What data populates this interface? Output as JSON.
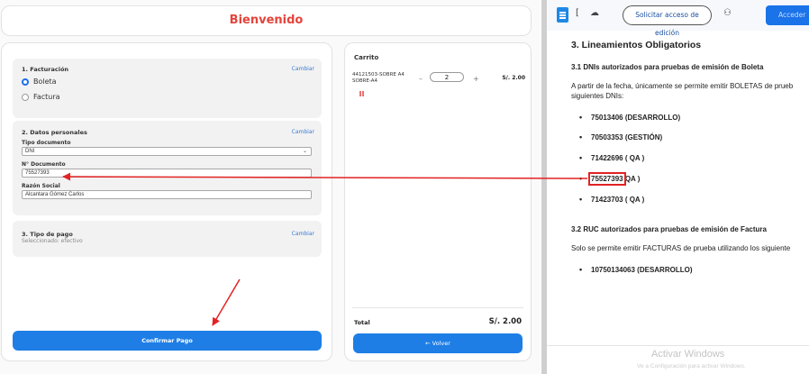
{
  "app": {
    "title": "Bienvenido",
    "billing": {
      "title": "1. Facturación",
      "change": "Cambiar",
      "options": [
        "Boleta",
        "Factura"
      ],
      "selected": "Boleta"
    },
    "personal": {
      "title": "2. Datos personales",
      "change": "Cambiar",
      "doc_type_label": "Tipo documento",
      "doc_type_value": "DNI",
      "doc_number_label": "N° Documento",
      "doc_number_value": "75527393",
      "name_label": "Razón Social",
      "name_value": "Alcantara Gómez Carlos"
    },
    "payment": {
      "title": "3. Tipo de pago",
      "subtitle": "Seleccionado: efectivo",
      "change": "Cambiar"
    },
    "confirm_label": "Confirmar Pago"
  },
  "cart": {
    "title": "Carrito",
    "items": [
      {
        "name": "44121503-SOBRE A4 SOBRE-A4",
        "qty": "2",
        "price": "S/. 2.00"
      }
    ],
    "minus": "–",
    "plus": "+",
    "total_label": "Total",
    "total_value": "S/. 2.00",
    "back_label": "← Volver"
  },
  "doc": {
    "toolbar": {
      "request_access": "Solicitar acceso de edición",
      "access": "Acceder"
    },
    "heading": "3. Lineamientos Obligatorios",
    "sec31": "3.1 DNIs autorizados para pruebas de emisión de Boleta",
    "sec31_p1": "A partir de la fecha, únicamente se permite emitir BOLETAS de prueb",
    "sec31_p2": "siguientes DNIs:",
    "dnis": [
      "75013406 (DESARROLLO)",
      "70503353 (GESTIÓN)",
      "71422696 ( QA )",
      "75527393",
      "71423703 ( QA )"
    ],
    "dni4_suffix": " QA )",
    "sec32": "3.2 RUC autorizados para pruebas de emisión de Factura",
    "sec32_p": "Solo se permite emitir FACTURAS de prueba utilizando los siguiente",
    "rucs": [
      "10750134063 (DESARROLLO)"
    ],
    "watermark1": "Activar Windows",
    "watermark2": "Ve a Configuración para activar Windows."
  },
  "colors": {
    "accent": "#1e7ee6",
    "title_red": "#e4443c",
    "annotation_red": "#e32222"
  }
}
